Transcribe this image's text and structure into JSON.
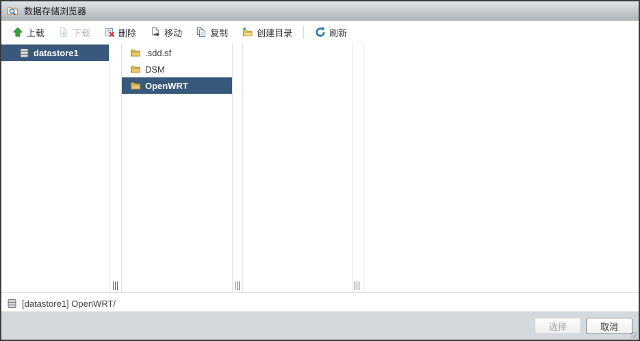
{
  "window": {
    "title": "数据存储浏览器"
  },
  "toolbar": {
    "upload": {
      "label": "上载",
      "enabled": true
    },
    "download": {
      "label": "下载",
      "enabled": false
    },
    "delete": {
      "label": "删除",
      "enabled": true
    },
    "move": {
      "label": "移动",
      "enabled": true
    },
    "copy": {
      "label": "复制",
      "enabled": true
    },
    "create_directory": {
      "label": "创建目录",
      "enabled": true
    },
    "refresh": {
      "label": "刷新",
      "enabled": true
    }
  },
  "browser": {
    "datastore_column": {
      "items": [
        {
          "name": "datastore1",
          "selected": true,
          "icon": "datastore-icon"
        }
      ]
    },
    "folder_column": {
      "items": [
        {
          "name": ".sdd.sf",
          "selected": false,
          "icon": "folder-icon"
        },
        {
          "name": "DSM",
          "selected": false,
          "icon": "folder-icon"
        },
        {
          "name": "OpenWRT",
          "selected": true,
          "icon": "folder-icon"
        }
      ]
    },
    "subfolder_column": {
      "items": []
    },
    "file_column": {
      "items": []
    }
  },
  "status_bar": {
    "path": "[datastore1] OpenWRT/"
  },
  "footer": {
    "select": {
      "label": "选择",
      "enabled": false
    },
    "cancel": {
      "label": "取消",
      "enabled": true
    }
  },
  "colors": {
    "selection_bg": "#38597b",
    "folder_yellow": "#e3bc4f",
    "upload_green": "#36a33c",
    "refresh_blue": "#1f74bd",
    "delete_red": "#cf3a2d",
    "footer_bg": "#d3d9dc"
  }
}
